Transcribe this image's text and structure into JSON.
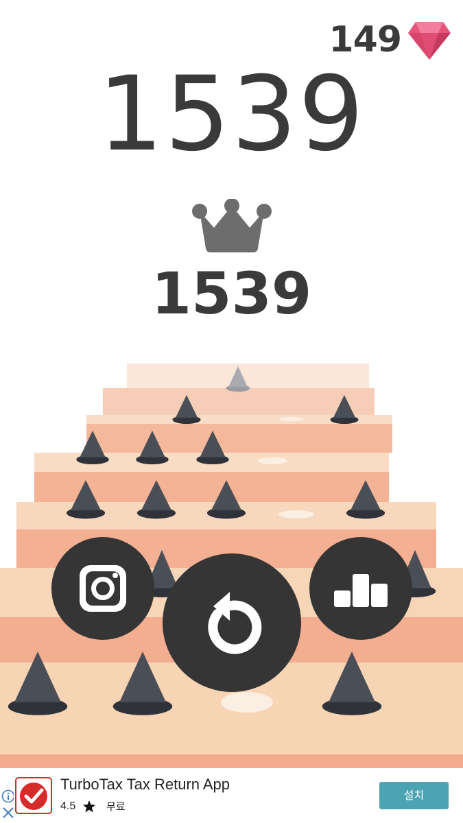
{
  "hud": {
    "gems": "149",
    "score": "1539",
    "best_score": "1539"
  },
  "colors": {
    "text_dark": "#3a3a3a",
    "gem": "#e8557a",
    "crown": "#6d6d6d",
    "button": "#353535",
    "step_top": "#f7d5b5",
    "step_front": "#f4b395",
    "spike": "#4a4e56",
    "install_button": "#4ca3b3"
  },
  "buttons": {
    "instagram_icon": "instagram-icon",
    "replay_icon": "replay-icon",
    "leaderboard_icon": "leaderboard-icon"
  },
  "ad": {
    "title": "TurboTax Tax Return App",
    "rating": "4.5",
    "price": "무료",
    "install_label": "설치",
    "icon": "checkmark-icon"
  }
}
